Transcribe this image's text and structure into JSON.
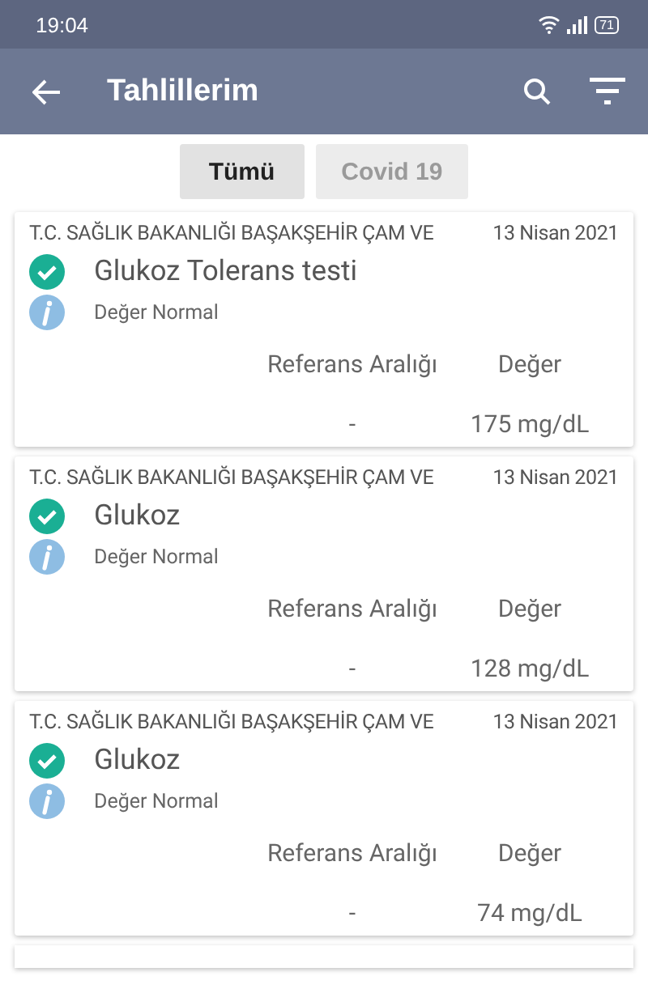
{
  "status_bar": {
    "time": "19:04",
    "battery": "71"
  },
  "toolbar": {
    "title": "Tahlillerim"
  },
  "filters": [
    {
      "label": "Tümü",
      "selected": true
    },
    {
      "label": "Covid 19",
      "selected": false
    }
  ],
  "results": [
    {
      "institution": "T.C. SAĞLIK BAKANLIĞI BAŞAKŞEHİR ÇAM VE",
      "date": "13 Nisan 2021",
      "test": "Glukoz Tolerans testi",
      "status": "Değer Normal",
      "normal": true,
      "reference_label": "Referans Aralığı",
      "value_label": "Değer",
      "reference": "-",
      "value": "175 mg/dL"
    },
    {
      "institution": "T.C. SAĞLIK BAKANLIĞI BAŞAKŞEHİR ÇAM VE",
      "date": "13 Nisan 2021",
      "test": "Glukoz",
      "status": "Değer Normal",
      "normal": true,
      "reference_label": "Referans Aralığı",
      "value_label": "Değer",
      "reference": "-",
      "value": "128 mg/dL"
    },
    {
      "institution": "T.C. SAĞLIK BAKANLIĞI BAŞAKŞEHİR ÇAM VE",
      "date": "13 Nisan 2021",
      "test": "Glukoz",
      "status": "Değer Normal",
      "normal": true,
      "reference_label": "Referans Aralığı",
      "value_label": "Değer",
      "reference": "-",
      "value": "74 mg/dL"
    }
  ]
}
